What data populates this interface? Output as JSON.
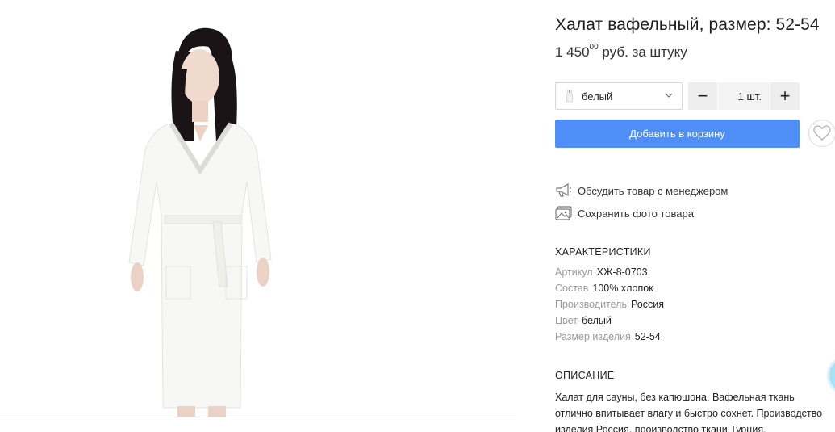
{
  "product": {
    "title": "Халат вафельный, размер: 52-54",
    "price_main": "1 450",
    "price_cents": "00",
    "price_unit": "руб. за штуку"
  },
  "color_select": {
    "value": "белый",
    "icon": "robe-thumbnail"
  },
  "quantity": {
    "value": "1",
    "unit": "шт.",
    "minus": "−",
    "plus": "+"
  },
  "add_to_cart": "Добавить в корзину",
  "favorite_icon": "heart-icon",
  "actions": {
    "discuss": "Обсудить товар с менеджером",
    "save_photo": "Сохранить фото товара"
  },
  "characteristics": {
    "title": "ХАРАКТЕРИСТИКИ",
    "rows": [
      {
        "key": "Артикул",
        "value": "ХЖ-8-0703"
      },
      {
        "key": "Состав",
        "value": "100% хлопок"
      },
      {
        "key": "Производитель",
        "value": "Россия"
      },
      {
        "key": "Цвет",
        "value": "белый"
      },
      {
        "key": "Размер изделия",
        "value": "52-54"
      }
    ]
  },
  "description": {
    "title": "ОПИСАНИЕ",
    "lines": [
      "Халат для сауны, без капюшона. Вафельная ткань",
      "отлично впитывает влагу и быстро сохнет. Производство",
      "изделия Россия, производство ткани Турция."
    ]
  },
  "colors": {
    "accent": "#4f8ef7",
    "muted": "#9a9a9a"
  }
}
